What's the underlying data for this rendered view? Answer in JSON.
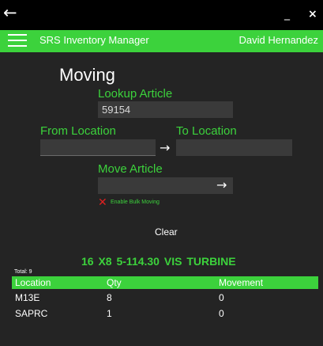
{
  "window": {
    "back_glyph": "←",
    "minimize_glyph": "_",
    "close_glyph": "×"
  },
  "appbar": {
    "title": "SRS Inventory Manager",
    "user": "David Hernandez"
  },
  "page": {
    "title": "Moving"
  },
  "lookup": {
    "label": "Lookup Article",
    "value": "59154"
  },
  "from_location": {
    "label": "From Location",
    "value": ""
  },
  "to_location": {
    "label": "To Location",
    "value": ""
  },
  "transfer_arrow": "→",
  "move_article": {
    "label": "Move Article",
    "value": "",
    "submit_glyph": "→"
  },
  "bulk": {
    "icon_glyph": "✕",
    "label": "Enable Bulk Moving"
  },
  "clear_label": "Clear",
  "total_label": "Total: 9",
  "article_description": "16 X8   5-114.30   VIS TURBINE",
  "grid": {
    "columns": [
      "Location",
      "Qty",
      "Movement"
    ],
    "rows": [
      [
        "M13E",
        "8",
        "0"
      ],
      [
        "SAPRC",
        "1",
        "0"
      ]
    ]
  },
  "colors": {
    "accent": "#3cd23c",
    "background": "#242424",
    "titlebar": "#000000",
    "textbox": "#3a3a3a",
    "error": "#e02020"
  },
  "icons": {
    "back": "back-arrow-icon",
    "menu": "hamburger-menu-icon",
    "minimize": "minimize-icon",
    "close": "close-icon",
    "arrow": "arrow-right-icon",
    "bulk": "x-mark-icon"
  }
}
